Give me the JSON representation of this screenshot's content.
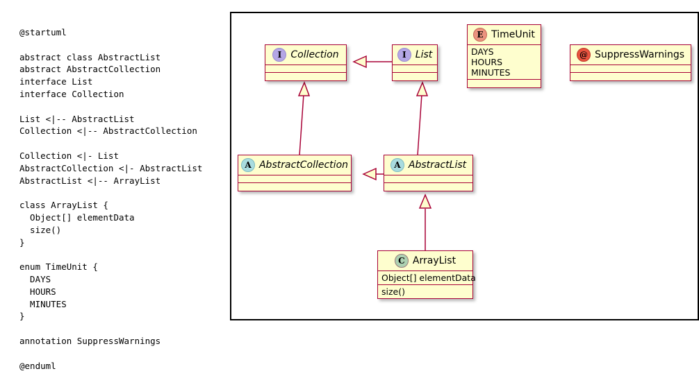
{
  "source": {
    "label": "plantuml-source",
    "code": "@startuml\n\nabstract class AbstractList\nabstract AbstractCollection\ninterface List\ninterface Collection\n\nList <|-- AbstractList\nCollection <|-- AbstractCollection\n\nCollection <|- List\nAbstractCollection <|- AbstractList\nAbstractList <|-- ArrayList\n\nclass ArrayList {\n  Object[] elementData\n  size()\n}\n\nenum TimeUnit {\n  DAYS\n  HOURS\n  MINUTES\n}\n\nannotation SuppressWarnings\n\n@enduml"
  },
  "colors": {
    "box_fill": "#fefece",
    "box_border": "#a80036",
    "frame_border": "#000000",
    "badge_interface": "#b4a7e5",
    "badge_abstract": "#a9dcdf",
    "badge_class": "#add1b2",
    "badge_enum": "#eb937f",
    "badge_annotation": "#e8533f"
  },
  "diagram": {
    "nodes": {
      "collection": {
        "name": "Collection",
        "stereotype": "interface",
        "badge_glyph": "I",
        "italic": true,
        "fields": [],
        "methods": []
      },
      "list": {
        "name": "List",
        "stereotype": "interface",
        "badge_glyph": "I",
        "italic": true,
        "fields": [],
        "methods": []
      },
      "timeunit": {
        "name": "TimeUnit",
        "stereotype": "enum",
        "badge_glyph": "E",
        "italic": false,
        "values": [
          "DAYS",
          "HOURS",
          "MINUTES"
        ]
      },
      "suppresswarnings": {
        "name": "SuppressWarnings",
        "stereotype": "annotation",
        "badge_glyph": "@",
        "italic": false,
        "fields": [],
        "methods": []
      },
      "abstractcollection": {
        "name": "AbstractCollection",
        "stereotype": "abstract",
        "badge_glyph": "A",
        "italic": true,
        "fields": [],
        "methods": []
      },
      "abstractlist": {
        "name": "AbstractList",
        "stereotype": "abstract",
        "badge_glyph": "A",
        "italic": true,
        "fields": [],
        "methods": []
      },
      "arraylist": {
        "name": "ArrayList",
        "stereotype": "class",
        "badge_glyph": "C",
        "italic": false,
        "field_1": "Object[] elementData",
        "method_1": "size()"
      }
    },
    "relations": [
      {
        "from": "List",
        "to": "Collection",
        "type": "extension"
      },
      {
        "from": "AbstractCollection",
        "to": "Collection",
        "type": "extension"
      },
      {
        "from": "AbstractList",
        "to": "List",
        "type": "extension"
      },
      {
        "from": "AbstractList",
        "to": "AbstractCollection",
        "type": "extension"
      },
      {
        "from": "ArrayList",
        "to": "AbstractList",
        "type": "extension"
      }
    ]
  }
}
